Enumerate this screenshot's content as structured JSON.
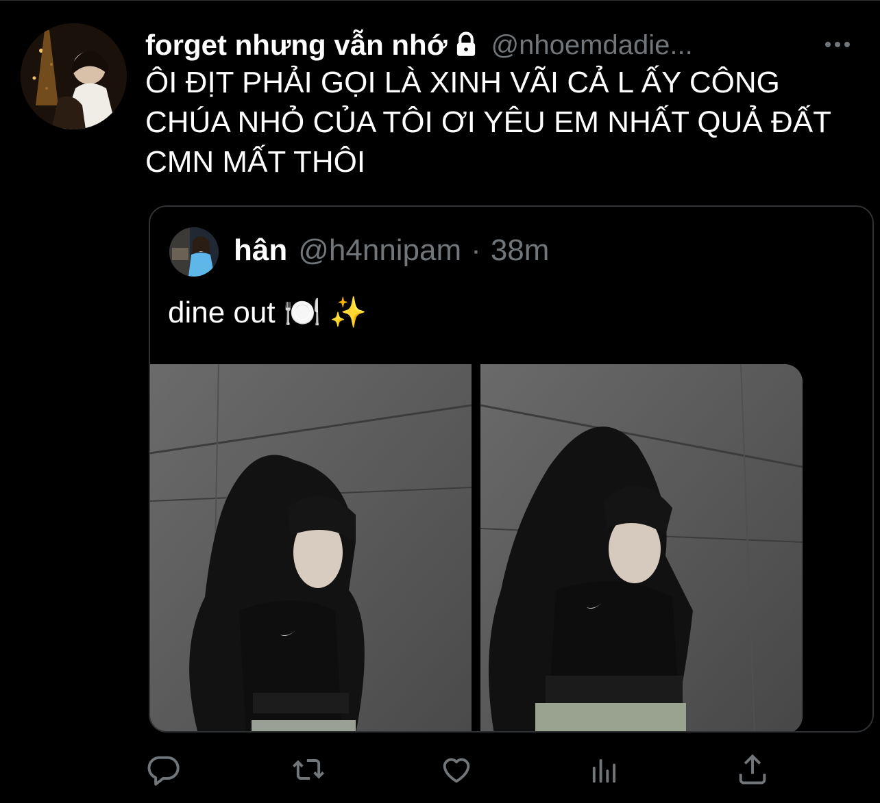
{
  "tweet": {
    "display_name": "forget nhưng vẫn nhớ",
    "handle": "@nhoemdadie...",
    "text": "ÔI ĐỊT PHẢI GỌI LÀ XINH VÃI CẢ L ẤY CÔNG CHÚA NHỎ CỦA TÔI ƠI YÊU EM NHẤT QUẢ ĐẤT CMN MẤT THÔI",
    "icons": {
      "lock": "lock-icon",
      "more": "more-icon"
    }
  },
  "quote": {
    "display_name": "hân",
    "handle": "@h4nnipam",
    "separator": "·",
    "time": "38m",
    "text": "dine out 🍽️ ✨",
    "media_count": 2
  },
  "actions": {
    "reply": "reply-icon",
    "retweet": "retweet-icon",
    "like": "like-icon",
    "analytics": "analytics-icon",
    "share": "share-icon"
  },
  "colors": {
    "background": "#000000",
    "primary_text": "#ffffff",
    "secondary_text": "#71767b",
    "border": "#2f3336"
  }
}
